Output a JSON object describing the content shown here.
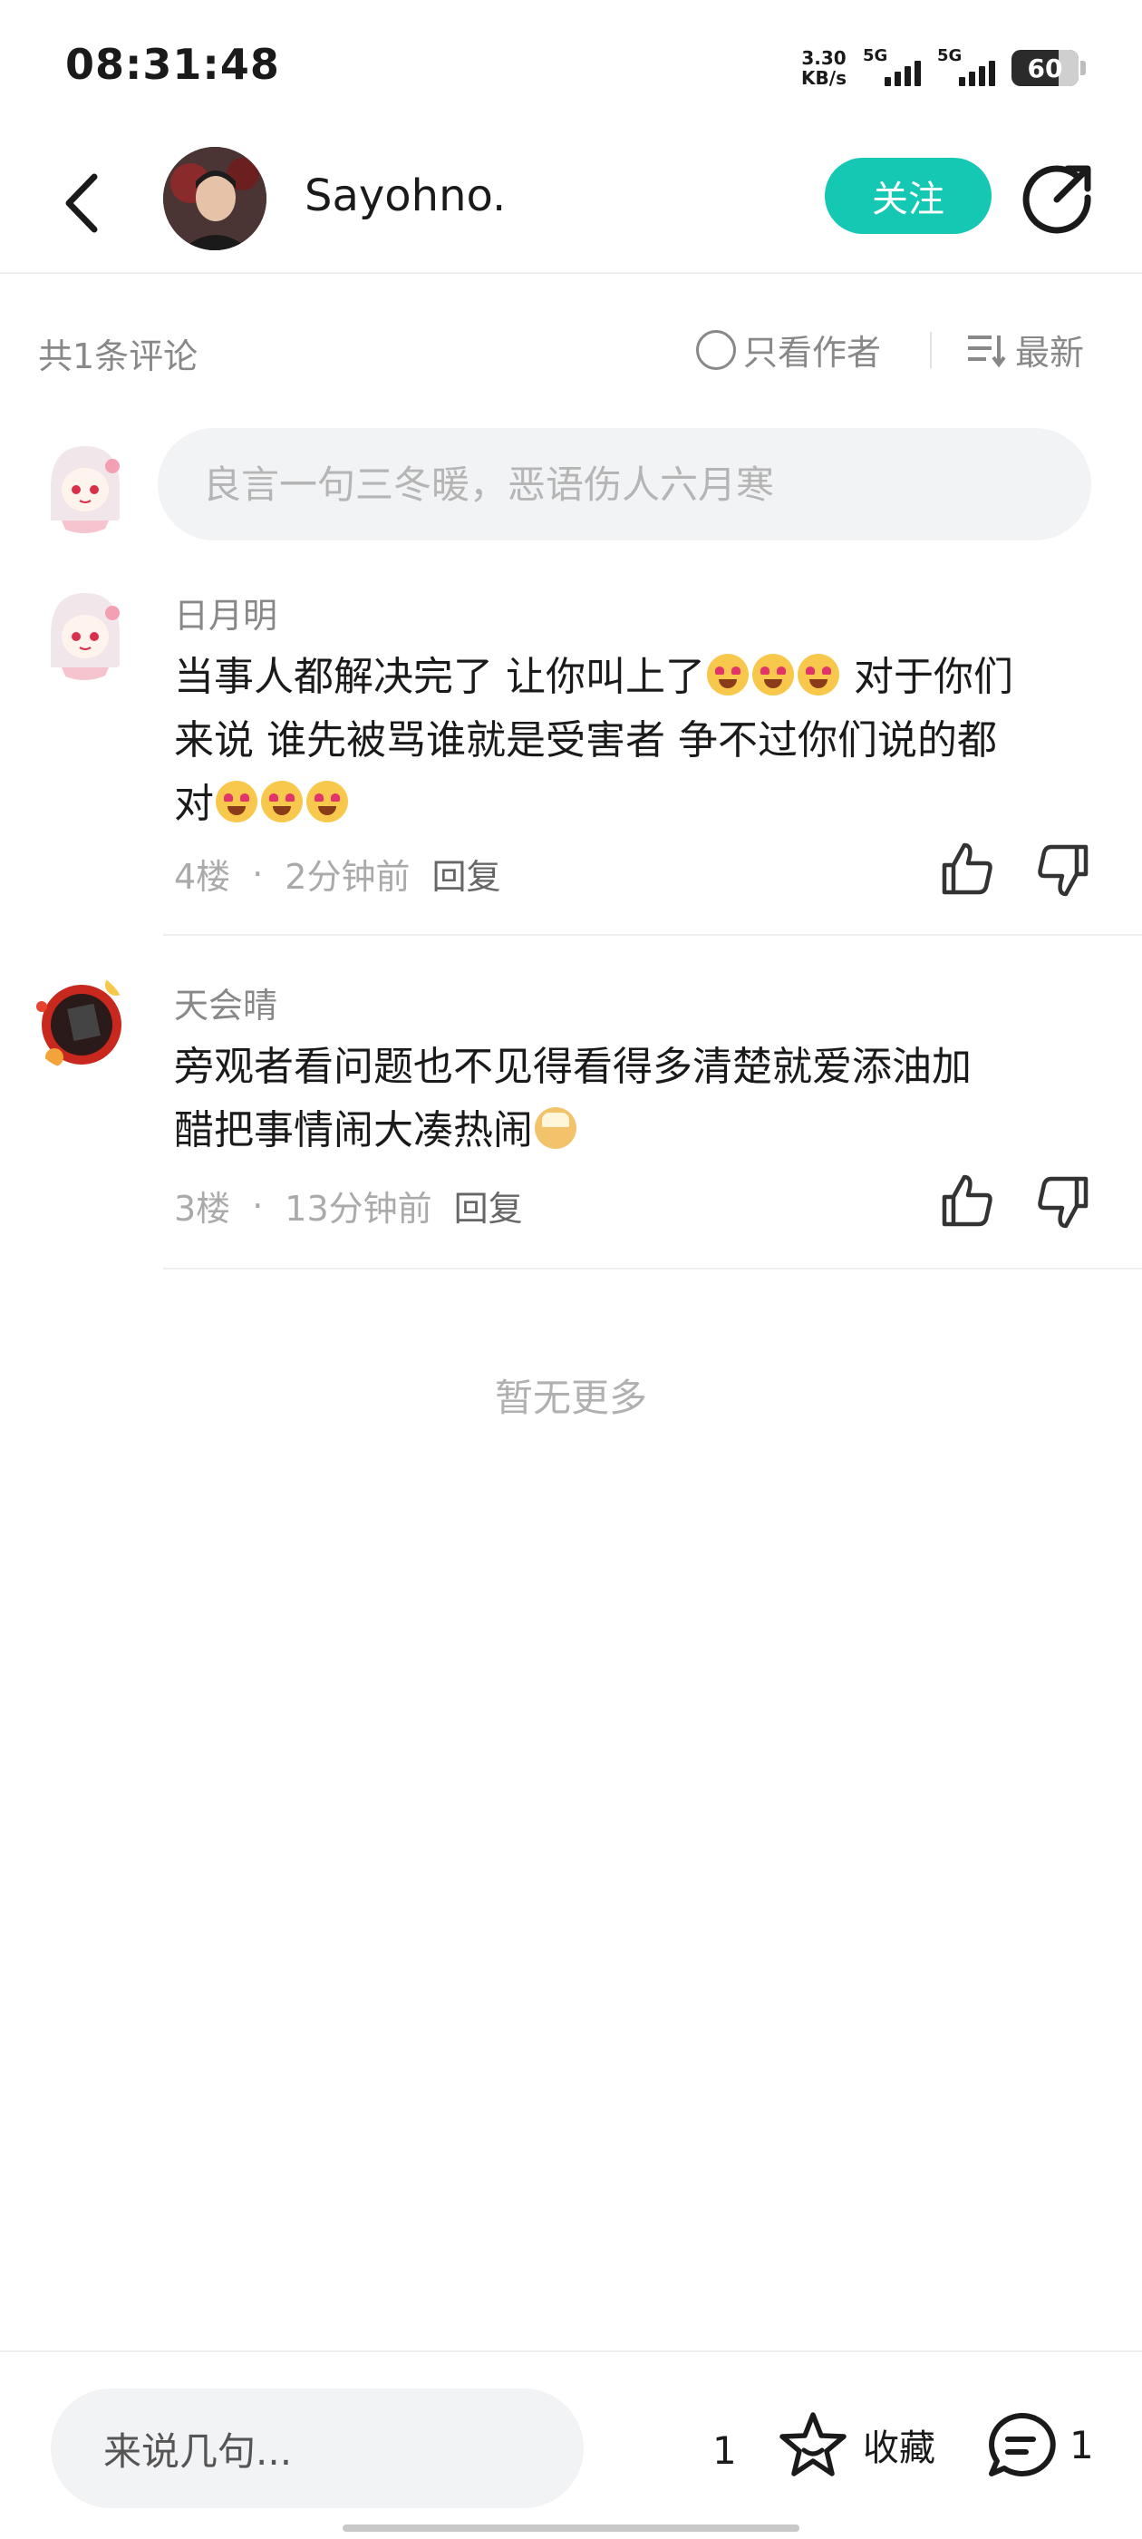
{
  "status_bar": {
    "time": "08:31:48",
    "net_speed_value": "3.30",
    "net_speed_unit": "KB/s",
    "signal1_label": "5G",
    "signal2_label": "5G",
    "battery": "60"
  },
  "header": {
    "username": "Sayohno.",
    "follow_label": "关注"
  },
  "toolbar": {
    "comment_count": "共1条评论",
    "author_only_label": "只看作者",
    "sort_label": "最新"
  },
  "comment_input": {
    "placeholder": "良言一句三冬暖，恶语伤人六月寒"
  },
  "comments": [
    {
      "name": "日月明",
      "text_line1": "当事人都解决完了 让你叫上了",
      "text_line1b": " 对于你们",
      "text_line2": "来说 谁先被骂谁就是受害者 争不过你们说的都",
      "text_line3": "对",
      "floor": "4楼",
      "time": "2分钟前",
      "reply_label": "回复"
    },
    {
      "name": "天会晴",
      "text_line1": "旁观者看问题也不见得看得多清楚就爱添油加",
      "text_line2": "醋把事情闹大凑热闹",
      "floor": "3楼",
      "time": "13分钟前",
      "reply_label": "回复"
    }
  ],
  "no_more_text": "暂无更多",
  "bottom_bar": {
    "say_placeholder": "来说几句...",
    "like_count": "1",
    "favorite_label": "收藏",
    "comment_count": "1"
  },
  "colors": {
    "accent": "#14c8b4",
    "text_primary": "#1a1a1a",
    "text_secondary": "#888888",
    "background": "#ffffff",
    "input_bg": "#f2f3f5"
  }
}
